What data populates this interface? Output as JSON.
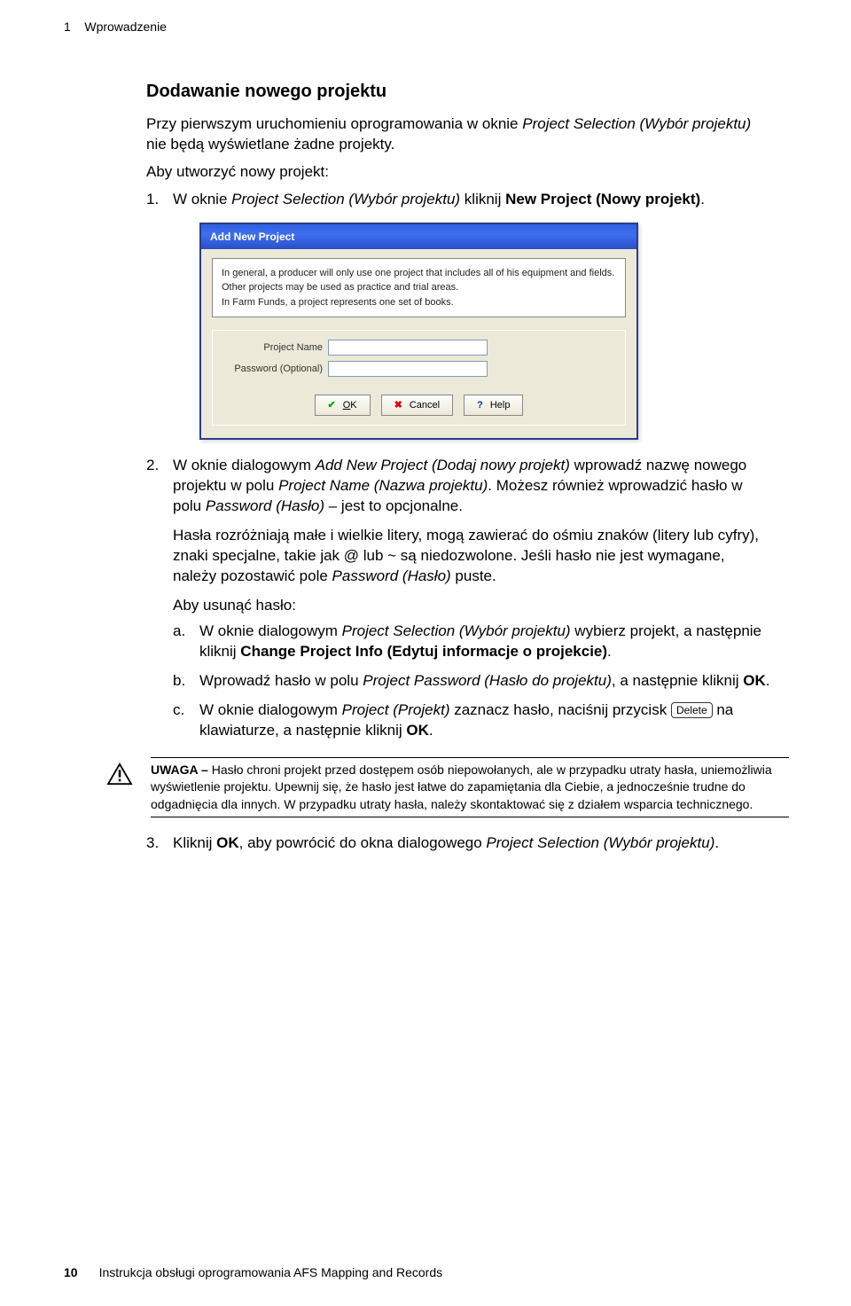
{
  "header": {
    "chapter_num": "1",
    "chapter_title": "Wprowadzenie"
  },
  "section": {
    "title": "Dodawanie nowego projektu",
    "intro_p1_a": "Przy pierwszym uruchomieniu oprogramowania w oknie ",
    "intro_p1_b": "Project Selection (Wybór projektu)",
    "intro_p1_c": " nie będą wyświetlane żadne projekty.",
    "intro_p2": "Aby utworzyć nowy projekt:"
  },
  "steps": {
    "s1_a": "W oknie ",
    "s1_b": "Project Selection (Wybór projektu)",
    "s1_c": " kliknij ",
    "s1_d": "New Project (Nowy projekt)",
    "s1_e": ".",
    "s2_a": "W oknie dialogowym ",
    "s2_b": "Add New Project (Dodaj nowy projekt)",
    "s2_c": " wprowadź nazwę nowego projektu w polu ",
    "s2_d": "Project Name (Nazwa projektu)",
    "s2_e": ". Możesz również wprowadzić hasło w polu ",
    "s2_f": "Password (Hasło)",
    "s2_g": " – jest to opcjonalne.",
    "s2_p2_a": "Hasła rozróżniają małe i wielkie litery, mogą zawierać do ośmiu znaków (litery lub cyfry), znaki specjalne, takie jak @ lub ~ są niedozwolone. Jeśli hasło nie jest wymagane, należy pozostawić pole ",
    "s2_p2_b": "Password (Hasło)",
    "s2_p2_c": " puste.",
    "s2_p3": "Aby usunąć hasło:",
    "s2a_a": "W oknie dialogowym ",
    "s2a_b": "Project Selection (Wybór projektu)",
    "s2a_c": " wybierz projekt, a następnie kliknij ",
    "s2a_d": "Change Project Info (Edytuj informacje o projekcie)",
    "s2a_e": ".",
    "s2b_a": "Wprowadź hasło w polu ",
    "s2b_b": "Project Password (Hasło do projektu)",
    "s2b_c": ", a następnie kliknij ",
    "s2b_d": "OK",
    "s2b_e": ".",
    "s2c_a": "W oknie dialogowym ",
    "s2c_b": "Project (Projekt)",
    "s2c_c": " zaznacz hasło, naciśnij przycisk ",
    "s2c_key": "Delete",
    "s2c_d": " na klawiaturze, a następnie kliknij ",
    "s2c_e": "OK",
    "s2c_f": ".",
    "s3_a": "Kliknij ",
    "s3_b": "OK",
    "s3_c": ", aby powrócić do okna dialogowego ",
    "s3_d": "Project Selection (Wybór projektu)",
    "s3_e": "."
  },
  "dialog": {
    "title": "Add New Project",
    "desc_l1": "In general, a producer will only use one project that includes all of his equipment and fields.",
    "desc_l2": "Other projects may be used as practice and trial areas.",
    "desc_l3": "In Farm Funds, a project represents one set of books.",
    "label_name": "Project Name",
    "label_pass": "Password  (Optional)",
    "btn_ok": "OK",
    "btn_cancel": "Cancel",
    "btn_help": "Help"
  },
  "caution": {
    "lead": "UWAGA – ",
    "text": "Hasło chroni projekt przed dostępem osób niepowołanych, ale w przypadku utraty hasła, uniemożliwia wyświetlenie projektu. Upewnij się, że hasło jest łatwe do zapamiętania dla Ciebie, a jednocześnie trudne do odgadnięcia dla innych. W przypadku utraty hasła, należy skontaktować się z działem wsparcia technicznego."
  },
  "footer": {
    "page_num": "10",
    "doc_title": "Instrukcja obsługi oprogramowania AFS Mapping and Records"
  }
}
